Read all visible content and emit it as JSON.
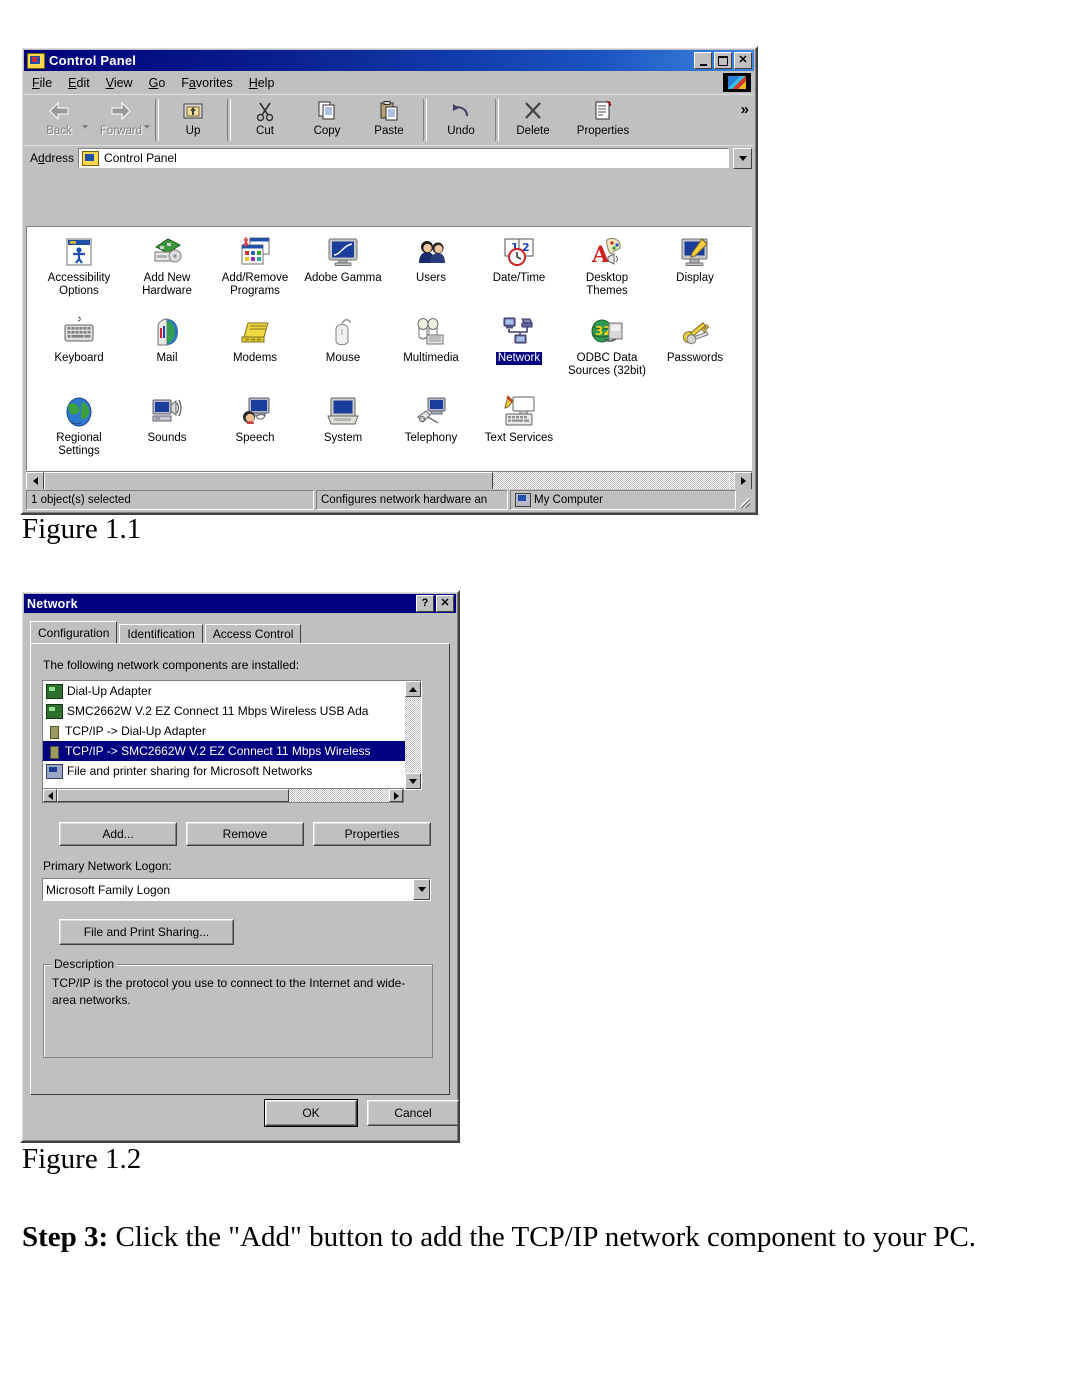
{
  "figure1": {
    "caption": "Figure 1.1",
    "window": {
      "title": "Control Panel",
      "title_icon": "control-panel-icon",
      "buttons": {
        "minimize": "minimize-icon",
        "maximize": "maximize-icon",
        "close": "close-icon"
      },
      "menu": [
        "File",
        "Edit",
        "View",
        "Go",
        "Favorites",
        "Help"
      ],
      "toolbar": {
        "items": [
          {
            "label": "Back",
            "icon": "back-arrow-icon",
            "disabled": true,
            "dropdown": true
          },
          {
            "label": "Forward",
            "icon": "forward-arrow-icon",
            "disabled": true,
            "dropdown": true
          },
          {
            "label": "Up",
            "icon": "up-folder-icon",
            "disabled": false,
            "dropdown": false
          },
          {
            "label": "Cut",
            "icon": "scissors-icon",
            "disabled": false,
            "dropdown": false
          },
          {
            "label": "Copy",
            "icon": "copy-pages-icon",
            "disabled": false,
            "dropdown": false
          },
          {
            "label": "Paste",
            "icon": "clipboard-paste-icon",
            "disabled": false,
            "dropdown": false
          },
          {
            "label": "Undo",
            "icon": "undo-arrow-icon",
            "disabled": false,
            "dropdown": false
          },
          {
            "label": "Delete",
            "icon": "delete-x-icon",
            "disabled": false,
            "dropdown": false
          },
          {
            "label": "Properties",
            "icon": "properties-icon",
            "disabled": false,
            "dropdown": false
          }
        ],
        "overflow": "»"
      },
      "address": {
        "label": "Address",
        "value": "Control Panel",
        "icon": "control-panel-icon",
        "dropdown": "chevron-down-icon"
      },
      "icons": [
        {
          "label": "Accessibility Options",
          "icon": "accessibility-icon",
          "selected": false
        },
        {
          "label": "Add New Hardware",
          "icon": "add-new-hardware-icon",
          "selected": false
        },
        {
          "label": "Add/Remove Programs",
          "icon": "add-remove-programs-icon",
          "selected": false
        },
        {
          "label": "Adobe Gamma",
          "icon": "adobe-gamma-icon",
          "selected": false
        },
        {
          "label": "Users",
          "icon": "users-icon",
          "selected": false
        },
        {
          "label": "Date/Time",
          "icon": "date-time-icon",
          "selected": false
        },
        {
          "label": "Desktop Themes",
          "icon": "desktop-themes-icon",
          "selected": false
        },
        {
          "label": "Display",
          "icon": "display-icon",
          "selected": false
        },
        {
          "label": "Keyboard",
          "icon": "keyboard-icon",
          "selected": false
        },
        {
          "label": "Mail",
          "icon": "mail-icon",
          "selected": false
        },
        {
          "label": "Modems",
          "icon": "modems-icon",
          "selected": false
        },
        {
          "label": "Mouse",
          "icon": "mouse-icon",
          "selected": false
        },
        {
          "label": "Multimedia",
          "icon": "multimedia-icon",
          "selected": false
        },
        {
          "label": "Network",
          "icon": "network-icon",
          "selected": true
        },
        {
          "label": "ODBC Data Sources (32bit)",
          "icon": "odbc-data-sources-icon",
          "selected": false
        },
        {
          "label": "Passwords",
          "icon": "passwords-key-icon",
          "selected": false
        },
        {
          "label": "Regional Settings",
          "icon": "regional-settings-icon",
          "selected": false
        },
        {
          "label": "Sounds",
          "icon": "sounds-icon",
          "selected": false
        },
        {
          "label": "Speech",
          "icon": "speech-icon",
          "selected": false
        },
        {
          "label": "System",
          "icon": "system-icon",
          "selected": false
        },
        {
          "label": "Telephony",
          "icon": "telephony-icon",
          "selected": false
        },
        {
          "label": "Text Services",
          "icon": "text-services-icon",
          "selected": false
        }
      ],
      "status": {
        "selection": "1 object(s) selected",
        "description": "Configures network hardware an",
        "location": "My Computer",
        "location_icon": "my-computer-icon"
      }
    }
  },
  "figure2": {
    "caption": "Figure 1.2",
    "dialog": {
      "title": "Network",
      "help_button": "?",
      "close_button": "✕",
      "tabs": [
        {
          "label": "Configuration",
          "active": true
        },
        {
          "label": "Identification",
          "active": false
        },
        {
          "label": "Access Control",
          "active": false
        }
      ],
      "list_label": "The following network components are installed:",
      "components": [
        {
          "text": "Dial-Up Adapter",
          "icon": "adapter-icon",
          "selected": false
        },
        {
          "text": "SMC2662W V.2 EZ Connect 11 Mbps Wireless USB Ada",
          "icon": "adapter-icon",
          "selected": false
        },
        {
          "text": "TCP/IP -> Dial-Up Adapter",
          "icon": "protocol-icon",
          "selected": false
        },
        {
          "text": "TCP/IP -> SMC2662W V.2 EZ Connect 11 Mbps Wireless",
          "icon": "protocol-icon",
          "selected": true
        },
        {
          "text": "File and printer sharing for Microsoft Networks",
          "icon": "sharing-icon",
          "selected": false
        }
      ],
      "buttons": {
        "add": "Add...",
        "remove": "Remove",
        "properties": "Properties"
      },
      "logon_label": "Primary Network Logon:",
      "logon_value": "Microsoft Family Logon",
      "file_print_sharing": "File and Print Sharing...",
      "description_title": "Description",
      "description_text": "TCP/IP is the protocol you use to connect to the Internet and wide-area networks.",
      "ok": "OK",
      "cancel": "Cancel"
    }
  },
  "step": {
    "prefix": "Step 3:",
    "body": " Click the \"Add\" button to add the TCP/IP network component to your PC."
  },
  "colors": {
    "titlebar_start": "#00007b",
    "titlebar_end": "#3f86dd",
    "selection": "#000080",
    "face": "#c0c0c0"
  }
}
